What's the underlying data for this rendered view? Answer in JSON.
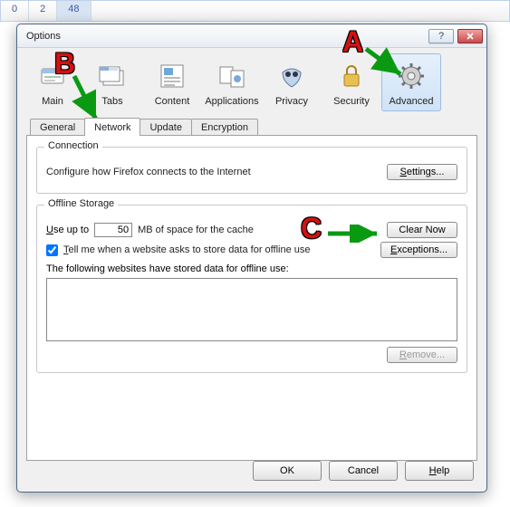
{
  "bgbar": {
    "c0": "0",
    "c1": "2",
    "c2": "48"
  },
  "dialog_title": "Options",
  "categories": [
    {
      "label": "Main"
    },
    {
      "label": "Tabs"
    },
    {
      "label": "Content"
    },
    {
      "label": "Applications"
    },
    {
      "label": "Privacy"
    },
    {
      "label": "Security"
    },
    {
      "label": "Advanced"
    }
  ],
  "subtabs": {
    "general": "General",
    "network": "Network",
    "update": "Update",
    "encryption": "Encryption"
  },
  "connection": {
    "title": "Connection",
    "text": "Configure how Firefox connects to the Internet",
    "btn": "Settings..."
  },
  "storage": {
    "title": "Offline Storage",
    "use_up_to_u": "U",
    "use_up_to_rest": "se up to",
    "value": "50",
    "mb": "MB of space for the cache",
    "clear": "Clear Now",
    "tell_u": "T",
    "tell_rest": "ell me when a website asks to store data for offline use",
    "exceptions": "Exceptions...",
    "following": "The following websites have stored data for offline use:",
    "remove_u": "R",
    "remove_rest": "emove..."
  },
  "buttons": {
    "ok": "OK",
    "cancel": "Cancel",
    "help_u": "H",
    "help_rest": "elp"
  },
  "anno": {
    "a": "A",
    "b": "B",
    "c": "C"
  }
}
